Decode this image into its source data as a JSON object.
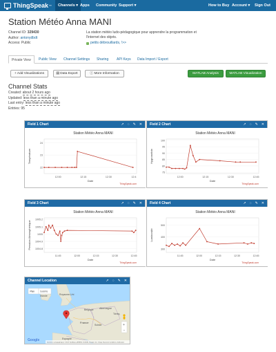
{
  "nav": {
    "brand": "ThingSpeak",
    "trademark": "™",
    "channels": "Channels ▾",
    "apps": "Apps",
    "community": "Community",
    "support": "Support ▾",
    "how_to_buy": "How to Buy",
    "account": "Account ▾",
    "sign_out": "Sign Out"
  },
  "channel": {
    "title": "Station Météo Anna MANI",
    "id_label": "Channel ID:",
    "id": "329430",
    "author_label": "Author:",
    "author": "antonydbdt",
    "access": "Access: Public",
    "description": "La station météo ludo-pédagogique pour apprendre la programmation et l'internet des objets.",
    "tag": "petits débrouillards, !>>"
  },
  "tabs": [
    "Private View",
    "Public View",
    "Channel Settings",
    "Sharing",
    "API Keys",
    "Data Import / Export"
  ],
  "buttons": {
    "add_viz": "+ Add Visualizations",
    "data_export": "Data Export",
    "more_info": "More Information",
    "matlab_analysis": "MATLAB Analysis",
    "matlab_viz": "MATLAB Visualization"
  },
  "stats": {
    "heading": "Channel Stats",
    "created_label": "Created:",
    "created": "about 2 hours ago",
    "updated_label": "Updated:",
    "updated": "less than a minute ago",
    "last_entry_label": "Last entry:",
    "last_entry": "less than a minute ago",
    "entries": "Entries: 95"
  },
  "panel_icons": [
    "↗",
    "◌",
    "✎",
    "✕"
  ],
  "chart_data": [
    {
      "type": "line",
      "panel": "Field 1 Chart",
      "title": "Station Météo Anna MANI",
      "xlabel": "Date",
      "ylabel": "Température",
      "xticks": [
        "12:00",
        "12:15",
        "12:30",
        "12:4"
      ],
      "yticks": [
        "22",
        "23",
        "24"
      ],
      "ylim": [
        21.5,
        24.3
      ],
      "color": "#c0392b",
      "credit": "ThingSpeak.com",
      "x": [
        0.0,
        0.05,
        0.12,
        0.19,
        0.25,
        0.3,
        0.33,
        0.35,
        0.36,
        0.96
      ],
      "y": [
        22.0,
        22.0,
        22.0,
        22.0,
        22.0,
        22.0,
        22.0,
        22.0,
        23.3,
        22.0
      ]
    },
    {
      "type": "line",
      "panel": "Field 2 Chart",
      "title": "Station Météo Anna MANI",
      "xlabel": "Date",
      "ylabel": "Hygrométrie",
      "xticks": [
        "12:00",
        "12:15",
        "12:30",
        "12:45"
      ],
      "yticks": [
        "75",
        "80",
        "85",
        "90",
        "95",
        "100"
      ],
      "ylim": [
        74,
        101
      ],
      "color": "#c0392b",
      "credit": "ThingSpeak.com",
      "x": [
        0.0,
        0.03,
        0.06,
        0.1,
        0.14,
        0.18,
        0.2,
        0.22,
        0.26,
        0.29,
        0.32,
        0.36,
        0.58,
        0.75,
        0.8,
        0.97
      ],
      "y": [
        79.0,
        79.0,
        78.0,
        78.0,
        78.0,
        78.0,
        77.5,
        78.5,
        96.0,
        88.0,
        83.0,
        85.0,
        84.0,
        83.0,
        83.0,
        83.0
      ]
    },
    {
      "type": "line",
      "panel": "Field 3 Chart",
      "title": "Station Météo Anna MANI",
      "xlabel": "Date",
      "ylabel": "Pression Atmosphérique",
      "xticks": [
        "11:45",
        "12:00",
        "12:15",
        "12:30",
        "12:45"
      ],
      "yticks": [
        "1004.8",
        "1004.9",
        "1005",
        "1005.1",
        "1005.2"
      ],
      "ylim": [
        1004.75,
        1005.22
      ],
      "color": "#c0392b",
      "credit": "ThingSpeak.com",
      "x": [
        0.0,
        0.02,
        0.04,
        0.05,
        0.07,
        0.09,
        0.11,
        0.13,
        0.15,
        0.17,
        0.18,
        0.19,
        0.2,
        0.22,
        0.25,
        0.95,
        0.97,
        0.99
      ],
      "y": [
        1005.02,
        1005.1,
        1005.05,
        1005.12,
        1005.08,
        1005.12,
        1005.05,
        1005.0,
        1004.98,
        1005.04,
        1004.9,
        1004.98,
        1005.02,
        1005.04,
        1005.05,
        1005.04,
        1005.02,
        1005.05
      ]
    },
    {
      "type": "line",
      "panel": "Field 4 Chart",
      "title": "Station Météo Anna MANI",
      "xlabel": "Date",
      "ylabel": "Luminosité",
      "xticks": [
        "11:45",
        "12:00",
        "12:15",
        "12:30",
        "12:45"
      ],
      "yticks": [
        "300",
        "400",
        "500"
      ],
      "ylim": [
        270,
        560
      ],
      "color": "#c0392b",
      "credit": "ThingSpeak.com",
      "x": [
        0.0,
        0.03,
        0.06,
        0.09,
        0.12,
        0.15,
        0.18,
        0.21,
        0.36,
        0.44,
        0.56,
        0.84,
        0.88,
        0.92,
        0.95
      ],
      "y": [
        330,
        320,
        345,
        330,
        340,
        325,
        350,
        330,
        470,
        360,
        340,
        350,
        340,
        350,
        345
      ]
    }
  ],
  "location": {
    "panel": "Channel Location",
    "map_btn": "Plan",
    "sat_btn": "Satellite",
    "google": "Google",
    "footer": "Données cartographiques ©2017 GeoBasis-DE/BKG (©2009), Google, Inst. Geogr. Nacional   Conditions d'utilisation",
    "labels": {
      "ireland": "Irlande",
      "uk": "Royaume-Uni",
      "germany": "Allemagne",
      "france": "France",
      "spain": "Espagne",
      "switzerland": "Suisse",
      "belgium": "Belgique",
      "czech": "Tchéq."
    }
  }
}
